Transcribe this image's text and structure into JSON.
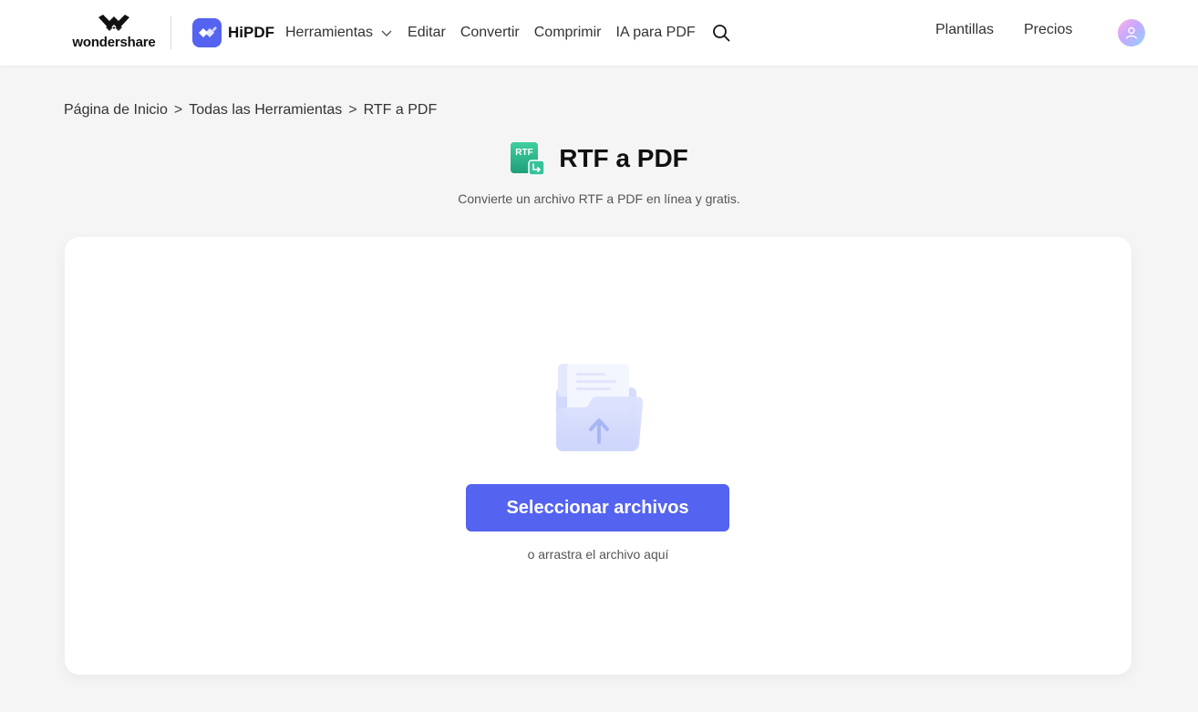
{
  "header": {
    "brand": "wondershare",
    "product": "HiPDF",
    "nav": [
      {
        "label": "Herramientas"
      },
      {
        "label": "Editar"
      },
      {
        "label": "Convertir"
      },
      {
        "label": "Comprimir"
      },
      {
        "label": "IA para PDF"
      }
    ],
    "right": {
      "templates": "Plantillas",
      "pricing": "Precios"
    }
  },
  "breadcrumb": {
    "home": "Página de Inicio",
    "tools": "Todas las Herramientas",
    "current": "RTF a PDF"
  },
  "tool": {
    "icon_label": "RTF",
    "title": "RTF a PDF",
    "subtitle": "Convierte un archivo RTF a PDF en línea y gratis."
  },
  "upload": {
    "button_label": "Seleccionar archivos",
    "drop_hint": "o arrastra el archivo aquí"
  },
  "colors": {
    "accent": "#5463f0",
    "tool_icon": "#2bb88f",
    "background": "#f5f5f5"
  }
}
